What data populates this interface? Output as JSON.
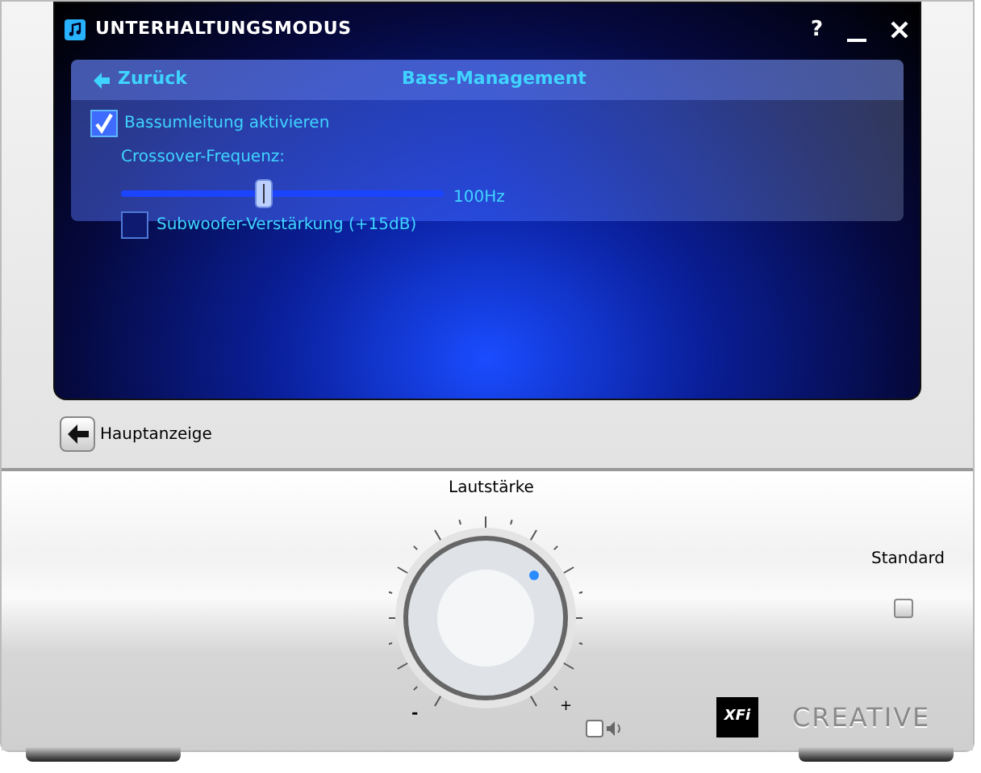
{
  "window": {
    "title": "UNTERHALTUNGSMODUS",
    "help": "?"
  },
  "panel": {
    "back": "Zurück",
    "title": "Bass-Management"
  },
  "bass_redirect": {
    "label": "Bassumleitung aktivieren",
    "checked": true
  },
  "crossover": {
    "label": "Crossover-Frequenz:",
    "level": 0.44,
    "reading": "100Hz"
  },
  "subwoofer_boost": {
    "label": "Subwoofer-Verstärkung (+15dB)",
    "checked": false
  },
  "main_view_button": {
    "label": "Hauptanzeige"
  },
  "volume": {
    "label": "Lautstärke",
    "level": 0.68,
    "min": "-",
    "max": "+",
    "muted": false
  },
  "standard": {
    "label": "Standard",
    "checked": false
  },
  "logos": {
    "xfi": "XFi",
    "brand": "CREATIVE"
  }
}
